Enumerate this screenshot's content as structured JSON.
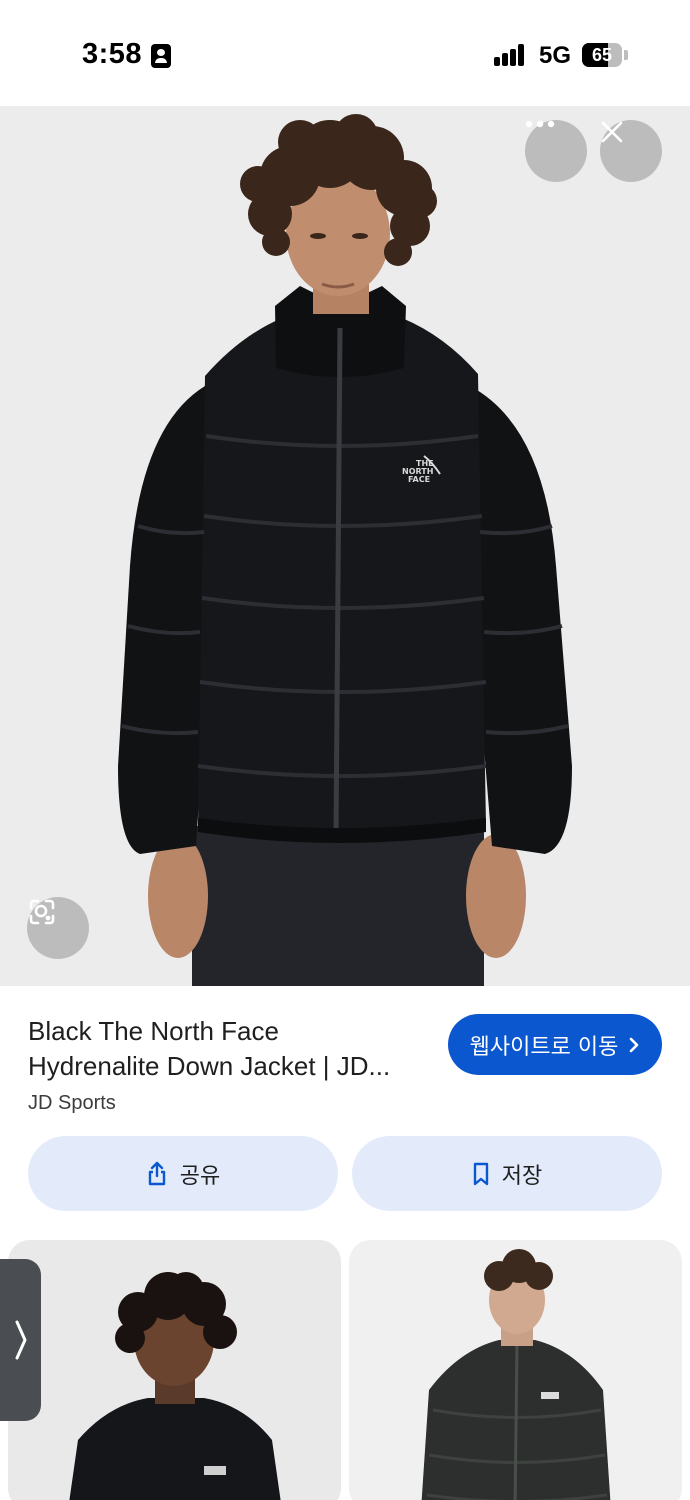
{
  "status_bar": {
    "time": "3:58",
    "network": "5G",
    "battery_percent": 65,
    "battery_label": "65",
    "icons": [
      "contact-card-icon",
      "signal-icon",
      "battery-icon"
    ]
  },
  "viewer": {
    "image_alt": "Man wearing black The North Face down jacket",
    "jacket_logo_lines": [
      "THE",
      "NORTH",
      "FACE"
    ],
    "icons": [
      "more-horizontal-icon",
      "close-icon",
      "lens-search-icon"
    ]
  },
  "product": {
    "title_line1": "Black The North Face",
    "title_line2": "Hydrenalite Down Jacket | JD...",
    "source": "JD Sports",
    "visit_label": "웹사이트로 이동",
    "share_label": "공유",
    "save_label": "저장"
  },
  "related": {
    "items": [
      {
        "alt": "Man with curly hair in black puffer jacket"
      },
      {
        "alt": "Man in dark puffer jacket"
      }
    ]
  },
  "colors": {
    "accent": "#0b57d0",
    "pill_bg": "#e3ebfb",
    "hero_bg": "#ececec"
  }
}
